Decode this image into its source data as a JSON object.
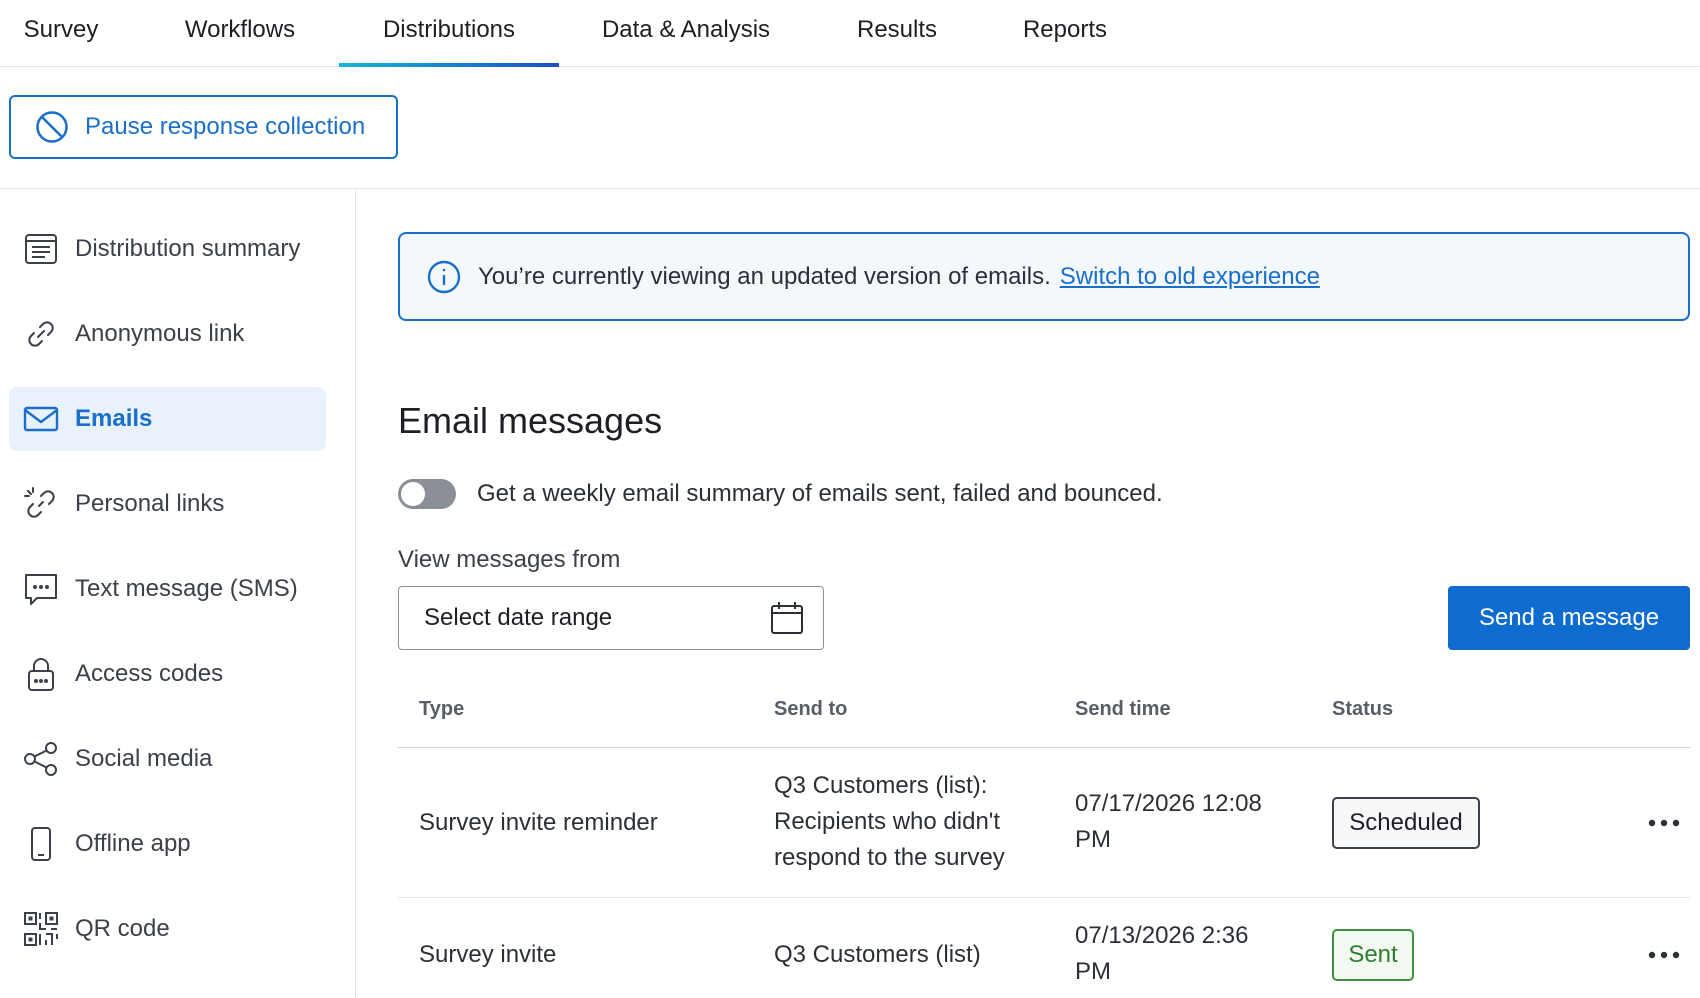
{
  "topnav": {
    "tabs": [
      {
        "label": "Survey"
      },
      {
        "label": "Workflows"
      },
      {
        "label": "Distributions"
      },
      {
        "label": "Data & Analysis"
      },
      {
        "label": "Results"
      },
      {
        "label": "Reports"
      }
    ],
    "active": "Distributions"
  },
  "toolbar": {
    "pause_label": "Pause response collection",
    "pause_icon": "prohibit-icon"
  },
  "sidebar": {
    "items": [
      {
        "label": "Distribution summary",
        "icon": "summary-list-icon"
      },
      {
        "label": "Anonymous link",
        "icon": "link-icon"
      },
      {
        "label": "Emails",
        "icon": "envelope-icon"
      },
      {
        "label": "Personal links",
        "icon": "broken-link-icon"
      },
      {
        "label": "Text message (SMS)",
        "icon": "sms-chat-icon"
      },
      {
        "label": "Access codes",
        "icon": "lock-icon"
      },
      {
        "label": "Social media",
        "icon": "share-icon"
      },
      {
        "label": "Offline app",
        "icon": "mobile-phone-icon"
      },
      {
        "label": "QR code",
        "icon": "qr-code-icon"
      }
    ],
    "active": "Emails"
  },
  "banner": {
    "text": "You’re currently viewing an updated version of emails.",
    "link": "Switch to old experience",
    "icon": "info-icon"
  },
  "main": {
    "title": "Email messages",
    "toggle_label": "Get a weekly email summary of emails sent, failed and bounced.",
    "toggle_on": false,
    "view_label": "View messages from",
    "date_placeholder": "Select date range",
    "send_label": "Send a message"
  },
  "table": {
    "headers": {
      "type": "Type",
      "send_to": "Send to",
      "send_time": "Send time",
      "status": "Status"
    },
    "rows": [
      {
        "type": "Survey invite reminder",
        "send_to": [
          "Q3 Customers (list):",
          "Recipients who didn't",
          "respond to the survey"
        ],
        "send_time": [
          "07/17/2026 12:08",
          "PM"
        ],
        "status": "Scheduled"
      },
      {
        "type": "Survey invite",
        "send_to": [
          "Q3 Customers (list)"
        ],
        "send_time": [
          "07/13/2026 2:36",
          "PM"
        ],
        "status": "Sent"
      }
    ]
  },
  "colors": {
    "accent": "#1a6fc9",
    "primary_button": "#0e6bd0",
    "sent": "#3f9142",
    "active_bg": "#e8f1fc"
  }
}
